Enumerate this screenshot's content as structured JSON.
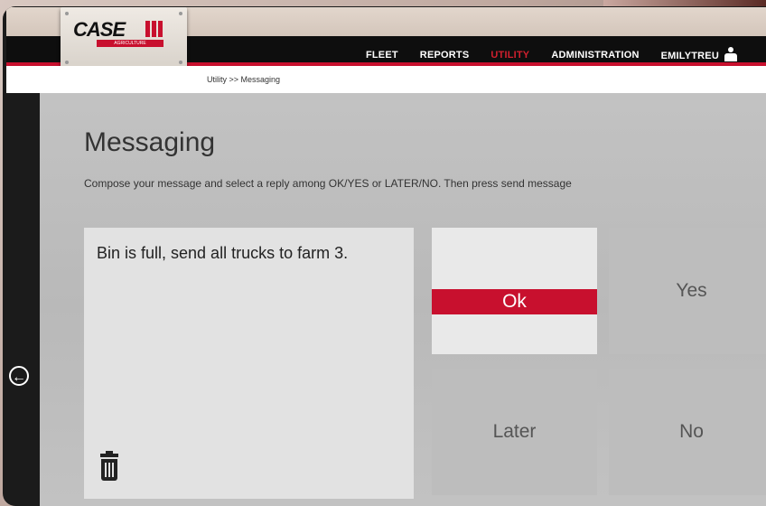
{
  "brand": {
    "logo_text": "CASE",
    "logo_sub": "AGRICULTURE"
  },
  "nav": {
    "items": [
      {
        "label": "FLEET",
        "active": false
      },
      {
        "label": "REPORTS",
        "active": false
      },
      {
        "label": "UTILITY",
        "active": true
      },
      {
        "label": "ADMINISTRATION",
        "active": false
      },
      {
        "label": "EMILYTREU",
        "active": false
      }
    ],
    "active_color": "#d0202e"
  },
  "breadcrumb": "Utility >> Messaging",
  "page": {
    "title": "Messaging",
    "subtitle": "Compose your message and select a reply among OK/YES or LATER/NO. Then press send message"
  },
  "message": {
    "text": "Bin is full, send all trucks to farm 3."
  },
  "replies": {
    "ok": "Ok",
    "yes": "Yes",
    "later": "Later",
    "no": "No",
    "selected": "Ok"
  },
  "colors": {
    "accent": "#c8102e",
    "topbar": "#0e0e0e"
  },
  "icons": {
    "back": "arrow-left-circle-icon",
    "trash": "trash-icon",
    "user": "user-icon"
  }
}
